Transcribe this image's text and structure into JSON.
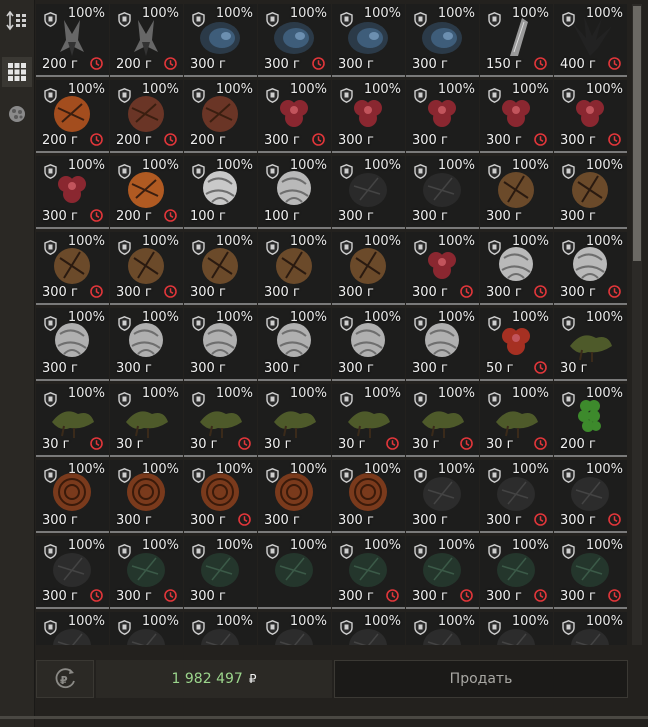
{
  "sidebar": {
    "buttons": [
      {
        "icon": "sort-icon",
        "active": false
      },
      {
        "icon": "grid-view-icon",
        "active": true
      },
      {
        "icon": "filter-icon",
        "active": false
      }
    ]
  },
  "inventory": {
    "columns": 8,
    "items": [
      {
        "durability": "100%",
        "weight": "200 г",
        "timer": true,
        "art": "arthropod",
        "color": "#7a7a7a"
      },
      {
        "durability": "100%",
        "weight": "200 г",
        "timer": true,
        "art": "arthropod",
        "color": "#7a7a7a"
      },
      {
        "durability": "100%",
        "weight": "300 г",
        "timer": false,
        "art": "crystal",
        "color": "#3e5d7a"
      },
      {
        "durability": "100%",
        "weight": "300 г",
        "timer": true,
        "art": "crystal",
        "color": "#3e5d7a"
      },
      {
        "durability": "100%",
        "weight": "300 г",
        "timer": false,
        "art": "crystal",
        "color": "#3e5d7a"
      },
      {
        "durability": "100%",
        "weight": "300 г",
        "timer": false,
        "art": "crystal",
        "color": "#3e5d7a"
      },
      {
        "durability": "100%",
        "weight": "150 г",
        "timer": true,
        "art": "horn",
        "color": "#9a9a9a"
      },
      {
        "durability": "100%",
        "weight": "400 г",
        "timer": true,
        "art": "spiky",
        "color": "#222222"
      },
      {
        "durability": "100%",
        "weight": "200 г",
        "timer": true,
        "art": "orange-lump",
        "color": "#a34d1e"
      },
      {
        "durability": "100%",
        "weight": "200 г",
        "timer": true,
        "art": "orange-lump",
        "color": "#6a3526"
      },
      {
        "durability": "100%",
        "weight": "200 г",
        "timer": false,
        "art": "orange-lump",
        "color": "#6a3526"
      },
      {
        "durability": "100%",
        "weight": "300 г",
        "timer": true,
        "art": "red-flower",
        "color": "#8a2730"
      },
      {
        "durability": "100%",
        "weight": "300 г",
        "timer": false,
        "art": "red-flower",
        "color": "#8a2730"
      },
      {
        "durability": "100%",
        "weight": "300 г",
        "timer": false,
        "art": "red-flower",
        "color": "#8a2730"
      },
      {
        "durability": "100%",
        "weight": "300 г",
        "timer": true,
        "art": "red-flower",
        "color": "#8a2730"
      },
      {
        "durability": "100%",
        "weight": "300 г",
        "timer": true,
        "art": "red-flower",
        "color": "#8a2730"
      },
      {
        "durability": "100%",
        "weight": "300 г",
        "timer": true,
        "art": "red-flower",
        "color": "#8a2730"
      },
      {
        "durability": "100%",
        "weight": "200 г",
        "timer": true,
        "art": "orange-lump",
        "color": "#b05a22"
      },
      {
        "durability": "100%",
        "weight": "100 г",
        "timer": false,
        "art": "white-flower",
        "color": "#c9c9c9"
      },
      {
        "durability": "100%",
        "weight": "100 г",
        "timer": false,
        "art": "white-flower",
        "color": "#b9b9b9"
      },
      {
        "durability": "100%",
        "weight": "300 г",
        "timer": false,
        "art": "dark-lump",
        "color": "#2a2a2a"
      },
      {
        "durability": "100%",
        "weight": "300 г",
        "timer": false,
        "art": "dark-lump",
        "color": "#2a2a2a"
      },
      {
        "durability": "100%",
        "weight": "300 г",
        "timer": false,
        "art": "bronze-lump",
        "color": "#6b4a2a"
      },
      {
        "durability": "100%",
        "weight": "300 г",
        "timer": false,
        "art": "bronze-lump",
        "color": "#6b4a2a"
      },
      {
        "durability": "100%",
        "weight": "300 г",
        "timer": true,
        "art": "bronze-lump",
        "color": "#6b4a2a"
      },
      {
        "durability": "100%",
        "weight": "300 г",
        "timer": true,
        "art": "bronze-lump",
        "color": "#6b4a2a"
      },
      {
        "durability": "100%",
        "weight": "300 г",
        "timer": false,
        "art": "bronze-lump",
        "color": "#6b4a2a"
      },
      {
        "durability": "100%",
        "weight": "300 г",
        "timer": false,
        "art": "bronze-lump",
        "color": "#6b4a2a"
      },
      {
        "durability": "100%",
        "weight": "300 г",
        "timer": false,
        "art": "bronze-lump",
        "color": "#6b4a2a"
      },
      {
        "durability": "100%",
        "weight": "300 г",
        "timer": true,
        "art": "red-flower",
        "color": "#8a2730"
      },
      {
        "durability": "100%",
        "weight": "300 г",
        "timer": true,
        "art": "white-flower",
        "color": "#b9b9b9"
      },
      {
        "durability": "100%",
        "weight": "300 г",
        "timer": true,
        "art": "white-flower",
        "color": "#b9b9b9"
      },
      {
        "durability": "100%",
        "weight": "300 г",
        "timer": false,
        "art": "white-flower",
        "color": "#b0b0b0"
      },
      {
        "durability": "100%",
        "weight": "300 г",
        "timer": false,
        "art": "white-flower",
        "color": "#b0b0b0"
      },
      {
        "durability": "100%",
        "weight": "300 г",
        "timer": false,
        "art": "white-flower",
        "color": "#b0b0b0"
      },
      {
        "durability": "100%",
        "weight": "300 г",
        "timer": false,
        "art": "white-flower",
        "color": "#b0b0b0"
      },
      {
        "durability": "100%",
        "weight": "300 г",
        "timer": false,
        "art": "white-flower",
        "color": "#b0b0b0"
      },
      {
        "durability": "100%",
        "weight": "300 г",
        "timer": false,
        "art": "white-flower",
        "color": "#b0b0b0"
      },
      {
        "durability": "100%",
        "weight": "50 г",
        "timer": true,
        "art": "red-flower",
        "color": "#a63022"
      },
      {
        "durability": "100%",
        "weight": "30 г",
        "timer": false,
        "art": "moss",
        "color": "#4e5a2a"
      },
      {
        "durability": "100%",
        "weight": "30 г",
        "timer": true,
        "art": "moss",
        "color": "#4e5a2a"
      },
      {
        "durability": "100%",
        "weight": "30 г",
        "timer": false,
        "art": "moss",
        "color": "#4e5a2a"
      },
      {
        "durability": "100%",
        "weight": "30 г",
        "timer": true,
        "art": "moss",
        "color": "#4e5a2a"
      },
      {
        "durability": "100%",
        "weight": "30 г",
        "timer": false,
        "art": "moss",
        "color": "#4e5a2a"
      },
      {
        "durability": "100%",
        "weight": "30 г",
        "timer": true,
        "art": "moss",
        "color": "#4e5a2a"
      },
      {
        "durability": "100%",
        "weight": "30 г",
        "timer": true,
        "art": "moss",
        "color": "#4e5a2a"
      },
      {
        "durability": "100%",
        "weight": "30 г",
        "timer": true,
        "art": "moss",
        "color": "#4e5a2a"
      },
      {
        "durability": "100%",
        "weight": "200 г",
        "timer": false,
        "art": "green-cluster",
        "color": "#3d8a2c"
      },
      {
        "durability": "100%",
        "weight": "300 г",
        "timer": false,
        "art": "coil",
        "color": "#7a3a1c"
      },
      {
        "durability": "100%",
        "weight": "300 г",
        "timer": false,
        "art": "coil",
        "color": "#7a3a1c"
      },
      {
        "durability": "100%",
        "weight": "300 г",
        "timer": true,
        "art": "coil",
        "color": "#7a3a1c"
      },
      {
        "durability": "100%",
        "weight": "300 г",
        "timer": false,
        "art": "coil",
        "color": "#7a3a1c"
      },
      {
        "durability": "100%",
        "weight": "300 г",
        "timer": false,
        "art": "coil",
        "color": "#7a3a1c"
      },
      {
        "durability": "100%",
        "weight": "300 г",
        "timer": false,
        "art": "dark-lump",
        "color": "#2c2c2c"
      },
      {
        "durability": "100%",
        "weight": "300 г",
        "timer": true,
        "art": "dark-lump",
        "color": "#2c2c2c"
      },
      {
        "durability": "100%",
        "weight": "300 г",
        "timer": true,
        "art": "dark-lump",
        "color": "#2c2c2c"
      },
      {
        "durability": "100%",
        "weight": "300 г",
        "timer": true,
        "art": "dark-lump",
        "color": "#2c2c2c"
      },
      {
        "durability": "100%",
        "weight": "300 г",
        "timer": true,
        "art": "dark-green-lump",
        "color": "#24362c"
      },
      {
        "durability": "100%",
        "weight": "300 г",
        "timer": false,
        "art": "dark-green-lump",
        "color": "#24362c"
      },
      {
        "durability": "100%",
        "weight": "",
        "timer": false,
        "art": "dark-green-lump",
        "color": "#24362c"
      },
      {
        "durability": "100%",
        "weight": "300 г",
        "timer": true,
        "art": "dark-green-lump",
        "color": "#24362c"
      },
      {
        "durability": "100%",
        "weight": "300 г",
        "timer": true,
        "art": "dark-green-lump",
        "color": "#24362c"
      },
      {
        "durability": "100%",
        "weight": "300 г",
        "timer": true,
        "art": "dark-green-lump",
        "color": "#24362c"
      },
      {
        "durability": "100%",
        "weight": "300 г",
        "timer": true,
        "art": "dark-green-lump",
        "color": "#24362c"
      },
      {
        "durability": "100%",
        "weight": "",
        "timer": false,
        "art": "dark-lump",
        "color": "#2c2c2c"
      },
      {
        "durability": "100%",
        "weight": "",
        "timer": false,
        "art": "dark-lump",
        "color": "#2c2c2c"
      },
      {
        "durability": "100%",
        "weight": "",
        "timer": false,
        "art": "dark-lump",
        "color": "#2c2c2c"
      },
      {
        "durability": "100%",
        "weight": "",
        "timer": false,
        "art": "dark-lump",
        "color": "#2c2c2c"
      },
      {
        "durability": "100%",
        "weight": "",
        "timer": false,
        "art": "dark-lump",
        "color": "#2c2c2c"
      },
      {
        "durability": "100%",
        "weight": "",
        "timer": false,
        "art": "dark-lump",
        "color": "#2c2c2c"
      },
      {
        "durability": "100%",
        "weight": "",
        "timer": false,
        "art": "dark-lump",
        "color": "#2c2c2c"
      },
      {
        "durability": "100%",
        "weight": "",
        "timer": false,
        "art": "dark-lump",
        "color": "#2c2c2c"
      }
    ]
  },
  "footer": {
    "balance": "1 982 497",
    "currency": "₽",
    "sell_label": "Продать",
    "refresh_icon": "ruble-refresh-icon"
  },
  "colors": {
    "accent_green": "#9bd58c",
    "timer_red": "#e0363a"
  }
}
